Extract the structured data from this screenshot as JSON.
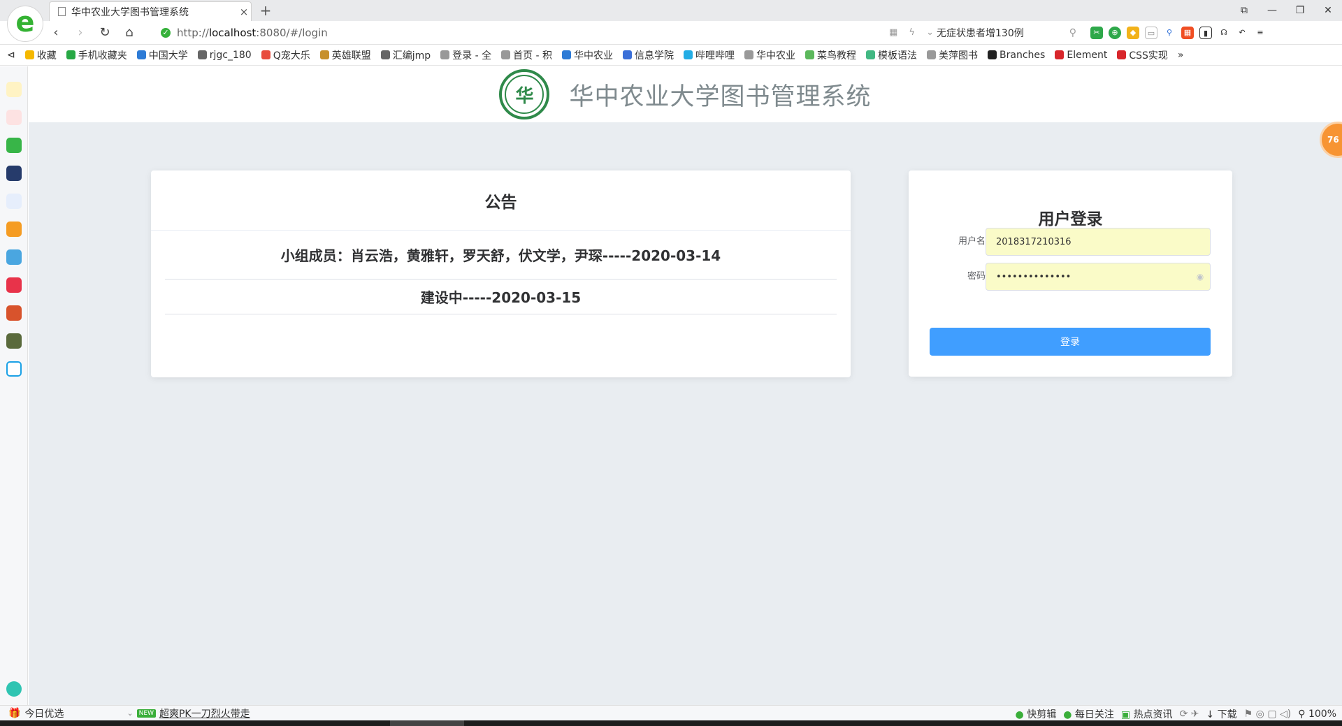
{
  "browser": {
    "tab_title": "华中农业大学图书管理系统",
    "tab_close": "×",
    "new_tab": "+",
    "url_prefix": "http://",
    "url_host": "localhost",
    "url_rest": ":8080/#/login",
    "news_search": "无症状患者增130例",
    "window_controls": [
      "⧉",
      "—",
      "❐",
      "✕"
    ]
  },
  "bookmarks": [
    {
      "label": "收藏",
      "color": "#f5b800"
    },
    {
      "label": "手机收藏夹",
      "color": "#27a844"
    },
    {
      "label": "中国大学",
      "color": "#2d7bd6"
    },
    {
      "label": "rjgc_180",
      "color": "#666666"
    },
    {
      "label": "Q宠大乐",
      "color": "#e84c3d"
    },
    {
      "label": "英雄联盟",
      "color": "#c7902b"
    },
    {
      "label": "汇编jmp",
      "color": "#666666"
    },
    {
      "label": "登录 - 全",
      "color": "#999999"
    },
    {
      "label": "首页 - 积",
      "color": "#999999"
    },
    {
      "label": "华中农业",
      "color": "#2d7bd6"
    },
    {
      "label": "信息学院",
      "color": "#3a6fd8"
    },
    {
      "label": "哔哩哔哩",
      "color": "#23ade5"
    },
    {
      "label": "华中农业",
      "color": "#999999"
    },
    {
      "label": "菜鸟教程",
      "color": "#5cb85c"
    },
    {
      "label": "模板语法",
      "color": "#42b883"
    },
    {
      "label": "美萍图书",
      "color": "#999999"
    },
    {
      "label": "Branches",
      "color": "#222222"
    },
    {
      "label": "Element",
      "color": "#d8262b"
    },
    {
      "label": "CSS实现",
      "color": "#d8262b"
    }
  ],
  "site": {
    "title": "华中农业大学图书管理系统",
    "logo_glyph": "华"
  },
  "notice": {
    "heading": "公告",
    "items": [
      "小组成员：肖云浩，黄雅轩，罗天舒，伏文学，尹琛-----2020-03-14",
      "建设中-----2020-03-15"
    ]
  },
  "login": {
    "heading": "用户登录",
    "username_label": "用户名",
    "username_value": "2018317210316",
    "password_label": "密码",
    "password_value": "••••••••••••••",
    "submit_label": "登录"
  },
  "float_badge": "76",
  "statusbar": {
    "left_label": "今日优选",
    "new_badge": "NEW",
    "promo": "超爽PK一刀烈火带走",
    "right_items": [
      "快剪辑",
      "每日关注",
      "热点资讯",
      "下载"
    ],
    "zoom": "100%"
  },
  "colors": {
    "accent": "#409eff",
    "page_bg": "#e9edf1",
    "logo_green": "#2f8a4a",
    "autofill": "#fafbc8"
  }
}
